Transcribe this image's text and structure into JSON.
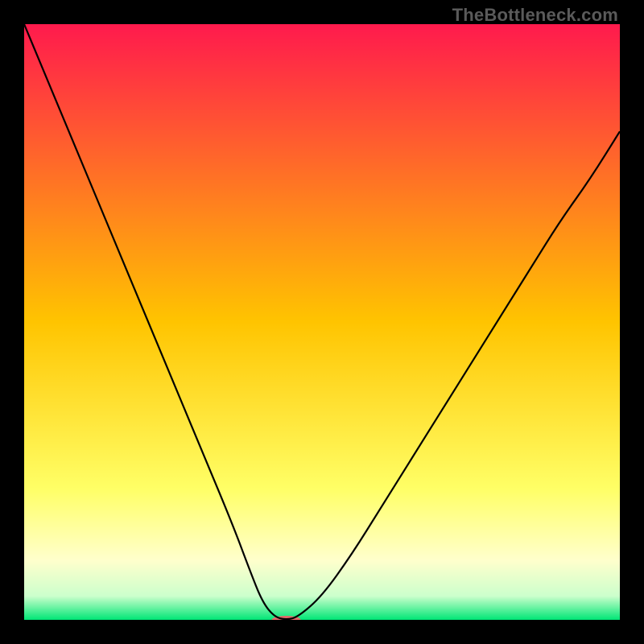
{
  "watermark": "TheBottleneck.com",
  "chart_data": {
    "type": "line",
    "title": "",
    "xlabel": "",
    "ylabel": "",
    "xlim": [
      0,
      100
    ],
    "ylim": [
      0,
      100
    ],
    "grid": false,
    "legend": false,
    "background_gradient": {
      "stops": [
        {
          "offset": 0.0,
          "color": "#ff1a4d"
        },
        {
          "offset": 0.5,
          "color": "#ffc400"
        },
        {
          "offset": 0.78,
          "color": "#ffff66"
        },
        {
          "offset": 0.9,
          "color": "#ffffcc"
        },
        {
          "offset": 0.96,
          "color": "#ccffcc"
        },
        {
          "offset": 1.0,
          "color": "#00e676"
        }
      ]
    },
    "series": [
      {
        "name": "bottleneck-curve",
        "x": [
          0,
          5,
          10,
          15,
          20,
          25,
          30,
          35,
          38,
          40,
          42,
          44,
          46,
          50,
          55,
          60,
          65,
          70,
          75,
          80,
          85,
          90,
          95,
          100
        ],
        "y": [
          100,
          88,
          76,
          64,
          52,
          40,
          28,
          16,
          8,
          3,
          0.5,
          0,
          0.5,
          4,
          11,
          19,
          27,
          35,
          43,
          51,
          59,
          67,
          74,
          82
        ]
      }
    ],
    "marker": {
      "x": 44,
      "y": 0,
      "color": "#e36a6a",
      "rx": 18,
      "ry": 5
    }
  }
}
